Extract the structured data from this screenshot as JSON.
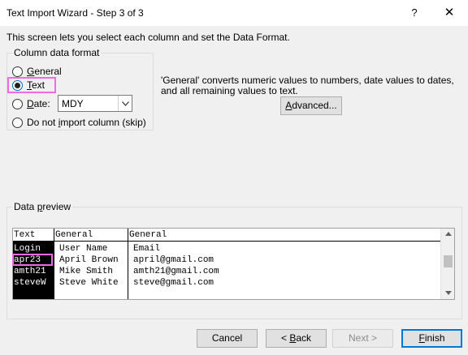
{
  "window": {
    "title": "Text Import Wizard - Step 3 of 3",
    "help_glyph": "?",
    "close_glyph": "✕"
  },
  "intro_text": "This screen lets you select each column and set the Data Format.",
  "column_format": {
    "legend": "Column data format",
    "options": [
      {
        "pre": "",
        "key": "G",
        "post": "eneral",
        "checked": false
      },
      {
        "pre": "",
        "key": "T",
        "post": "ext",
        "checked": true
      },
      {
        "pre": "",
        "key": "D",
        "post": "ate:",
        "checked": false
      },
      {
        "pre": "Do not ",
        "key": "i",
        "post": "mport column (skip)",
        "checked": false
      }
    ],
    "date_value": "MDY"
  },
  "info_text": "'General' converts numeric values to numbers, date values to dates, and all remaining values to text.",
  "advanced_button": {
    "pre": "",
    "key": "A",
    "post": "dvanced..."
  },
  "preview": {
    "legend_pre": "Data ",
    "legend_key": "p",
    "legend_post": "review",
    "headers": [
      "Text",
      "General",
      "General"
    ],
    "rows": [
      [
        "Login",
        "User Name",
        "Email"
      ],
      [
        "apr23",
        "April Brown",
        "april@gmail.com"
      ],
      [
        "amth21",
        "Mike Smith",
        "amth21@gmail.com"
      ],
      [
        "steveW",
        "Steve White",
        "steve@gmail.com"
      ]
    ]
  },
  "buttons": {
    "cancel": "Cancel",
    "back_pre": "< ",
    "back_key": "B",
    "back_post": "ack",
    "next": "Next >",
    "finish_key": "F",
    "finish_post": "inish"
  },
  "icons": {
    "dropdown": "chevron-down-icon",
    "scroll_up": "triangle-up-icon",
    "scroll_down": "triangle-down-icon"
  },
  "colors": {
    "highlight": "#f06ae6",
    "accent": "#0078d7"
  }
}
